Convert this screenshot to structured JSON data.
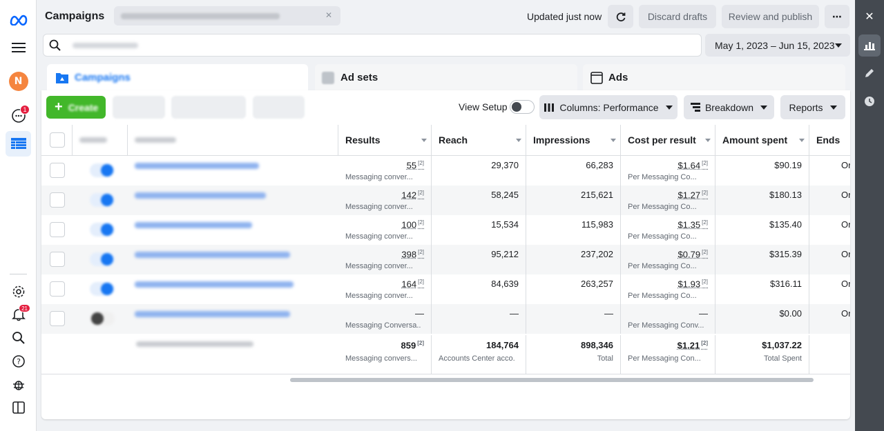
{
  "header": {
    "title": "Campaigns",
    "updated": "Updated just now",
    "discard": "Discard drafts",
    "review": "Review and publish"
  },
  "search": {
    "placeholder": "Search and filter"
  },
  "date_range": "May 1, 2023 – Jun 15, 2023",
  "tabs": [
    {
      "label": "Campaigns"
    },
    {
      "label": "Ad sets"
    },
    {
      "label": "Ads"
    }
  ],
  "toolbar": {
    "create": "Create",
    "view_setup": "View Setup",
    "columns": "Columns: Performance",
    "breakdown": "Breakdown",
    "reports": "Reports"
  },
  "columns": [
    "Results",
    "Reach",
    "Impressions",
    "Cost per result",
    "Amount spent",
    "Ends"
  ],
  "rows": [
    {
      "results": "55",
      "results_sub": "Messaging conver...",
      "reach": "29,370",
      "impressions": "66,283",
      "cpr": "$1.64",
      "cpr_sub": "Per Messaging Co...",
      "spent": "$90.19",
      "ends": "Or"
    },
    {
      "results": "142",
      "results_sub": "Messaging conver...",
      "reach": "58,245",
      "impressions": "215,621",
      "cpr": "$1.27",
      "cpr_sub": "Per Messaging Co...",
      "spent": "$180.13",
      "ends": "Or"
    },
    {
      "results": "100",
      "results_sub": "Messaging conver...",
      "reach": "15,534",
      "impressions": "115,983",
      "cpr": "$1.35",
      "cpr_sub": "Per Messaging Co...",
      "spent": "$135.40",
      "ends": "Or"
    },
    {
      "results": "398",
      "results_sub": "Messaging conver...",
      "reach": "95,212",
      "impressions": "237,202",
      "cpr": "$0.79",
      "cpr_sub": "Per Messaging Co...",
      "spent": "$315.39",
      "ends": "Or"
    },
    {
      "results": "164",
      "results_sub": "Messaging conver...",
      "reach": "84,639",
      "impressions": "263,257",
      "cpr": "$1.93",
      "cpr_sub": "Per Messaging Co...",
      "spent": "$316.11",
      "ends": "Or"
    },
    {
      "results": "—",
      "results_sub": "Messaging Conversa...",
      "reach": "—",
      "impressions": "—",
      "cpr": "—",
      "cpr_sub": "Per Messaging Conv...",
      "spent": "$0.00",
      "ends": "Or"
    }
  ],
  "totals": {
    "results": "859",
    "results_sub": "Messaging convers...",
    "reach": "184,764",
    "reach_sub": "Accounts Center acco...",
    "impressions": "898,346",
    "impressions_sub": "Total",
    "cpr": "$1.21",
    "cpr_sub": "Per Messaging Con...",
    "spent": "$1,037.22",
    "spent_sub": "Total Spent"
  },
  "sup_marker": "[2]",
  "nav": {
    "messages_badge": "1",
    "notifications_badge": "21",
    "avatar_initial": "N"
  }
}
